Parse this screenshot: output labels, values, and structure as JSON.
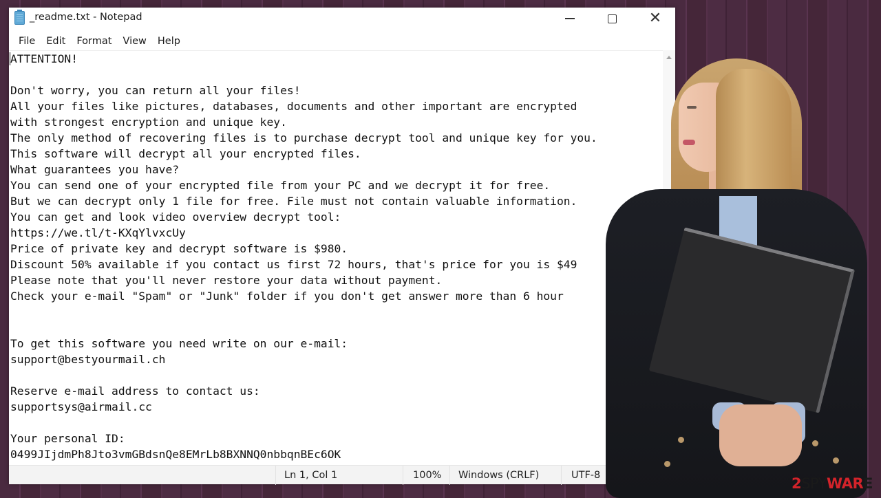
{
  "window": {
    "title": "_readme.txt - Notepad",
    "app_icon": "notepad-icon",
    "controls": {
      "minimize": "minimize-icon",
      "maximize": "maximize-icon",
      "close_glyph": "✕"
    }
  },
  "menu": {
    "items": [
      {
        "label": "File"
      },
      {
        "label": "Edit"
      },
      {
        "label": "Format"
      },
      {
        "label": "View"
      },
      {
        "label": "Help"
      }
    ]
  },
  "document": {
    "lines": [
      "ATTENTION!",
      "",
      "Don't worry, you can return all your files!",
      "All your files like pictures, databases, documents and other important are encrypted",
      "with strongest encryption and unique key.",
      "The only method of recovering files is to purchase decrypt tool and unique key for you.",
      "This software will decrypt all your encrypted files.",
      "What guarantees you have?",
      "You can send one of your encrypted file from your PC and we decrypt it for free.",
      "But we can decrypt only 1 file for free. File must not contain valuable information.",
      "You can get and look video overview decrypt tool:",
      "https://we.tl/t-KXqYlvxcUy",
      "Price of private key and decrypt software is $980.",
      "Discount 50% available if you contact us first 72 hours, that's price for you is $49",
      "Please note that you'll never restore your data without payment.",
      "Check your e-mail \"Spam\" or \"Junk\" folder if you don't get answer more than 6 hour",
      "",
      "",
      "To get this software you need write on our e-mail:",
      "support@bestyourmail.ch",
      "",
      "Reserve e-mail address to contact us:",
      "supportsys@airmail.cc",
      "",
      "Your personal ID:",
      "0499JIjdmPh8Jto3vmGBdsnQe8EMrLb8BXNNQ0nbbqnBEc6OK"
    ]
  },
  "statusbar": {
    "position": "Ln 1, Col 1",
    "zoom": "100%",
    "line_ending": "Windows (CRLF)",
    "encoding": "UTF-8"
  },
  "watermark": {
    "num": "2",
    "spy": "SPY",
    "war": "WAR",
    "e": "E"
  },
  "colors": {
    "background": "#4a2a40",
    "watermark_red": "#d3232a"
  }
}
